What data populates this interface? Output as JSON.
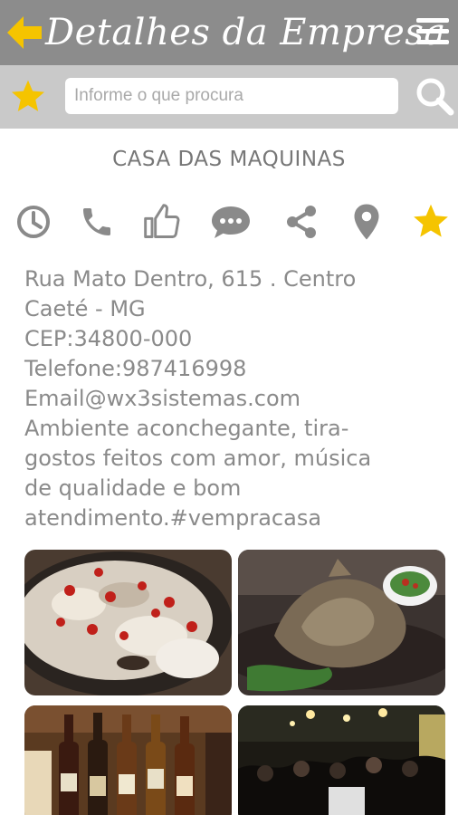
{
  "header": {
    "title": "Detalhes da Empresa"
  },
  "search": {
    "placeholder": "Informe o que procura"
  },
  "company": {
    "name": "CASA DAS MAQUINAS",
    "address_line1": "Rua Mato Dentro, 615 .  Centro",
    "address_line2": "Caeté - MG",
    "cep": "CEP:34800-000",
    "phone": "Telefone:987416998",
    "email": "Email@wx3sistemas.com",
    "description_lines": [
      "Ambiente aconchegante, tira-",
      "gostos feitos com amor, música",
      "de qualidade e bom",
      "atendimento.#vempracasa"
    ]
  },
  "actions": [
    "clock-icon",
    "phone-icon",
    "thumbs-up-icon",
    "chat-icon",
    "share-icon",
    "map-pin-icon",
    "star-icon"
  ],
  "colors": {
    "header_bg": "#8c8c8c",
    "search_bg": "#c9c9c9",
    "accent_yellow": "#f5c400",
    "icon_gray": "#8a8a8a",
    "text_gray": "#8a8a8a"
  },
  "photos": [
    "pizza-photo",
    "snack-platter-photo",
    "beer-bottles-photo",
    "live-music-crowd-photo"
  ]
}
